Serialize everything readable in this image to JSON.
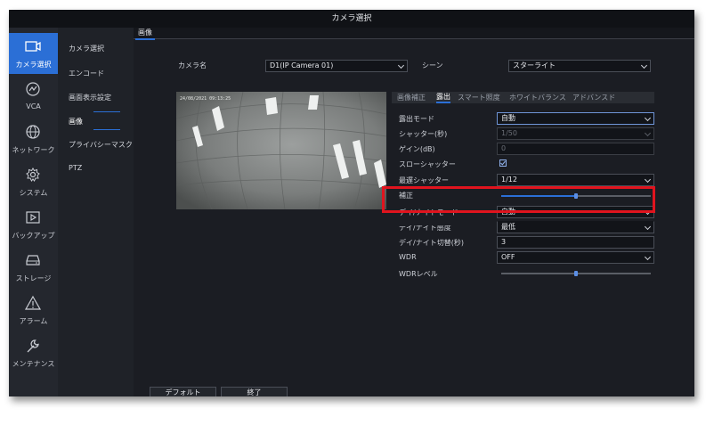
{
  "window": {
    "title": "カメラ選択"
  },
  "nav": [
    {
      "label": "カメラ選択",
      "icon": "camera-icon",
      "active": true
    },
    {
      "label": "VCA",
      "icon": "vca-icon",
      "active": false
    },
    {
      "label": "ネットワーク",
      "icon": "globe-icon",
      "active": false
    },
    {
      "label": "システム",
      "icon": "gear-icon",
      "active": false
    },
    {
      "label": "バックアップ",
      "icon": "backup-icon",
      "active": false
    },
    {
      "label": "ストレージ",
      "icon": "storage-icon",
      "active": false
    },
    {
      "label": "アラーム",
      "icon": "alarm-icon",
      "active": false
    },
    {
      "label": "メンテナンス",
      "icon": "wrench-icon",
      "active": false
    }
  ],
  "subnav": [
    {
      "label": "カメラ選択"
    },
    {
      "label": "エンコード"
    },
    {
      "label": "画面表示設定"
    },
    {
      "label": "画像",
      "active": true
    },
    {
      "label": "プライバシーマスク"
    },
    {
      "label": "PTZ"
    }
  ],
  "main": {
    "tab": "画像",
    "camera_label": "カメラ名",
    "camera_value": "D1(IP Camera 01)",
    "scene_label": "シーン",
    "scene_value": "スターライト",
    "preview_timestamp": "24/08/2021 09:13:25"
  },
  "subtabs": [
    {
      "label": "画像補正",
      "active": false
    },
    {
      "label": "露出",
      "active": true
    },
    {
      "label": "スマート照度",
      "active": false
    },
    {
      "label": "ホワイトバランス",
      "active": false
    },
    {
      "label": "アドバンスド",
      "active": false
    }
  ],
  "settings": {
    "exposure_mode": {
      "label": "露出モード",
      "value": "自動"
    },
    "shutter": {
      "label": "シャッター(秒)",
      "value": "1/50"
    },
    "gain": {
      "label": "ゲイン(dB)",
      "value": "0"
    },
    "slow_shutter": {
      "label": "スローシャッター",
      "checked": true
    },
    "max_shutter": {
      "label": "最遅シャッター",
      "value": "1/12"
    },
    "compensation": {
      "label": "補正",
      "level": 0.5
    },
    "day_night_mode": {
      "label": "デイ/ナイトモード",
      "value": "自動"
    },
    "day_night_sensitivity": {
      "label": "デイ/ナイト感度",
      "value": "最低"
    },
    "day_night_switch": {
      "label": "デイ/ナイト切替(秒)",
      "value": "3"
    },
    "wdr": {
      "label": "WDR",
      "value": "OFF"
    },
    "wdr_level": {
      "label": "WDRレベル",
      "level": 0.5
    }
  },
  "buttons": {
    "default": "デフォルト",
    "exit": "終了"
  },
  "colors": {
    "accent": "#2b6fd6",
    "highlight": "#e0141e"
  }
}
